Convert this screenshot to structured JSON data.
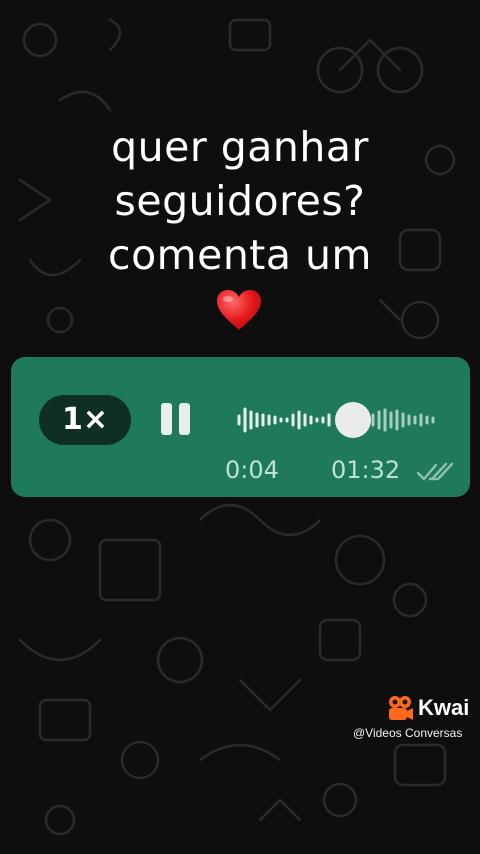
{
  "caption": {
    "line1": "quer ganhar",
    "line2": "seguidores?",
    "line3": "comenta um"
  },
  "emoji": "heart",
  "voice_message": {
    "speed_label": "1×",
    "elapsed": "0:04",
    "duration": "01:32",
    "status_icon": "double-check-icon",
    "progress": 0.5,
    "bubble_color": "#1f7a5c"
  },
  "watermark": {
    "brand": "Kwai",
    "handle": "@Videos Conversas",
    "logo_color": "#ff6a1a"
  }
}
